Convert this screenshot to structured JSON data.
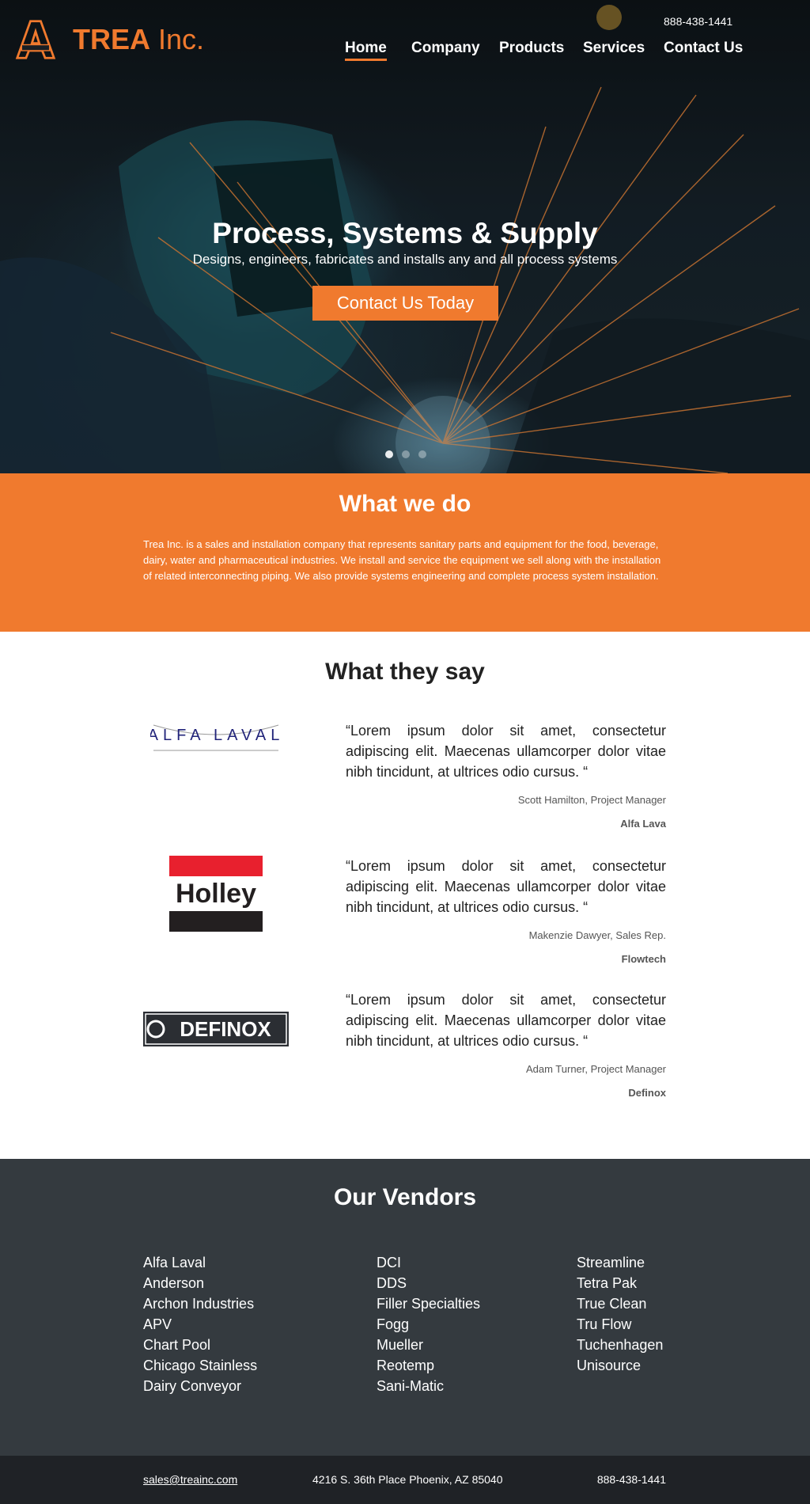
{
  "header": {
    "logo": {
      "brand": "TREA",
      "suffix": "Inc.",
      "mark_text": "TREA"
    },
    "phone": "888-438-1441",
    "nav": [
      {
        "label": "Home",
        "active": true
      },
      {
        "label": "Company",
        "active": false
      },
      {
        "label": "Products",
        "active": false
      },
      {
        "label": "Services",
        "active": false
      },
      {
        "label": "Contact Us",
        "active": false
      }
    ]
  },
  "hero": {
    "title": "Process, Systems & Supply",
    "subtitle": "Designs, engineers, fabricates and installs any and all process systems",
    "cta_label": "Contact Us Today",
    "slides": 3,
    "active_slide": 1
  },
  "what_we_do": {
    "title": "What we do",
    "body": "Trea Inc. is a sales and installation company that represents sanitary parts and equipment for the food, beverage, dairy, water and pharmaceutical industries. We install and service the equipment we sell along with the installation of related interconnecting piping. We also provide systems engineering and complete process system installation."
  },
  "testimonials": {
    "title": "What they say",
    "items": [
      {
        "logo": "alfa-laval-logo",
        "logo_text": "ALFA LAVAL",
        "quote": "“Lorem ipsum dolor sit amet, consectetur adipiscing elit. Maecenas ullamcorper dolor vitae nibh tincidunt, at ultrices odio cursus. “",
        "author": "Scott Hamilton, Project Manager",
        "company": "Alfa Lava"
      },
      {
        "logo": "holley-logo",
        "logo_text": "Holley",
        "quote": "“Lorem ipsum dolor sit amet, consectetur adipiscing elit. Maecenas ullamcorper dolor vitae nibh tincidunt, at ultrices odio cursus. “",
        "author": "Makenzie Dawyer, Sales Rep.",
        "company": "Flowtech"
      },
      {
        "logo": "definox-logo",
        "logo_text": "DEFINOX",
        "quote": "“Lorem ipsum dolor sit amet, consectetur adipiscing elit. Maecenas ullamcorper dolor vitae nibh tincidunt, at ultrices odio cursus. “",
        "author": "Adam Turner, Project Manager",
        "company": "Definox"
      }
    ]
  },
  "vendors": {
    "title": "Our Vendors",
    "columns": [
      [
        "Alfa Laval",
        "Anderson",
        "Archon Industries",
        "APV",
        "Chart Pool",
        "Chicago Stainless",
        "Dairy Conveyor"
      ],
      [
        "DCI",
        "DDS",
        "Filler Specialties",
        "Fogg",
        "Mueller",
        "Reotemp",
        "Sani-Matic"
      ],
      [
        "Streamline",
        "Tetra Pak",
        "True Clean",
        "Tru Flow",
        "Tuchenhagen",
        "Unisource"
      ]
    ]
  },
  "footer": {
    "email": "sales@treainc.com",
    "address": "4216 S. 36th Place Phoenix, AZ 85040",
    "phone": "888-438-1441"
  },
  "colors": {
    "accent": "#f07a2e",
    "vendors_bg": "#343a3f",
    "footer_bg": "#1f2226"
  }
}
